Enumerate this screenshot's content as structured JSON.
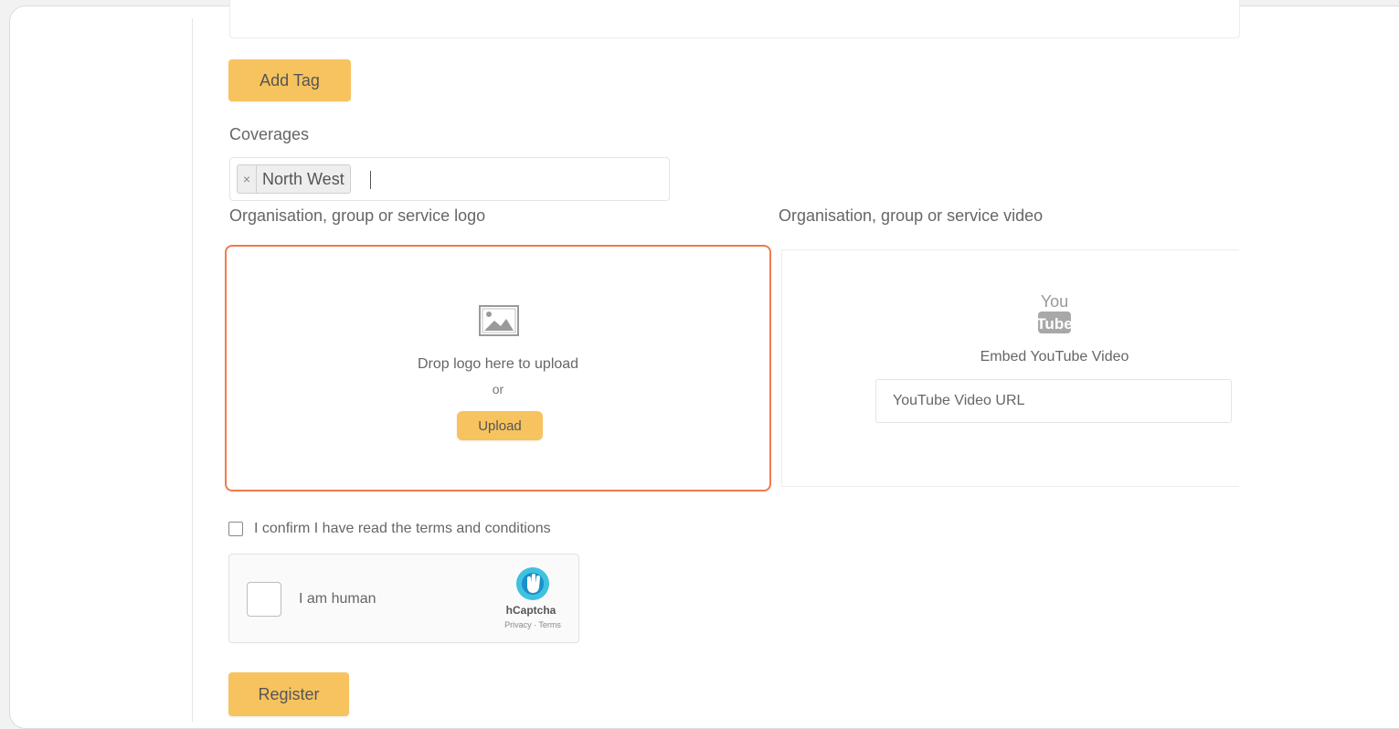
{
  "form": {
    "add_tag_label": "Add Tag",
    "coverages_label": "Coverages",
    "coverages": [
      {
        "remove_glyph": "×",
        "label": "North West"
      }
    ],
    "logo_label": "Organisation, group or service logo",
    "video_label": "Organisation, group or service video",
    "logo_upload": {
      "icon": "image-icon",
      "drop_text": "Drop logo here to upload",
      "or_text": "or",
      "upload_label": "Upload",
      "border_color": "#f27a4b"
    },
    "video": {
      "icon": "youtube-icon",
      "embed_text": "Embed YouTube Video",
      "url_placeholder": "YouTube Video URL"
    },
    "terms_label": "I confirm I have read the terms and conditions",
    "captcha": {
      "label": "I am human",
      "brand": "hCaptcha",
      "links": "Privacy · Terms"
    },
    "register_label": "Register"
  },
  "colors": {
    "button_bg": "#f7c35f",
    "dropzone_border": "#f27a4b",
    "text": "#666666"
  }
}
